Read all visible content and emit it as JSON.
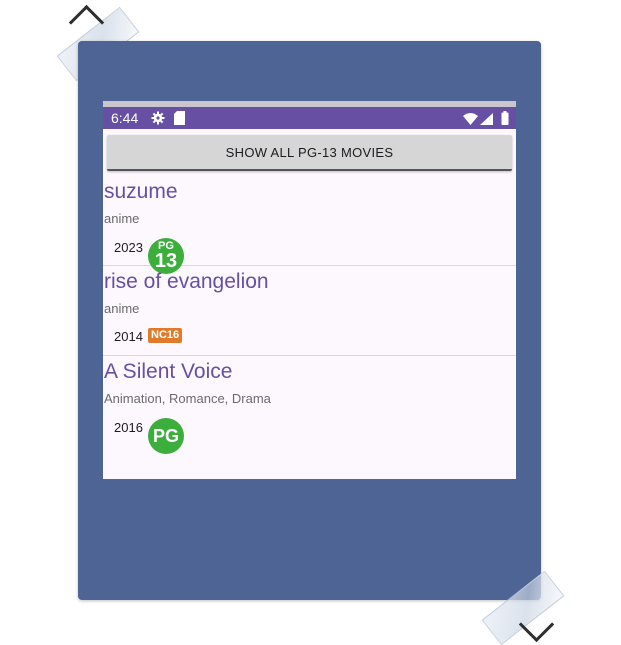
{
  "status_bar": {
    "time": "6:44",
    "icons": [
      "gear-icon",
      "sd-card-icon",
      "wifi-icon",
      "signal-icon",
      "battery-icon"
    ]
  },
  "action_button": {
    "label": "SHOW ALL PG-13 MOVIES"
  },
  "movies": [
    {
      "title": "suzume",
      "genre": "anime",
      "year": "2023",
      "rating": "PG13",
      "rating_top": "PG",
      "rating_bottom": "13"
    },
    {
      "title": "rise of evangelion",
      "genre": "anime",
      "year": "2014",
      "rating": "NC16"
    },
    {
      "title": "A Silent Voice",
      "genre": "Animation, Romance, Drama",
      "year": "2016",
      "rating": "PG"
    }
  ],
  "colors": {
    "accent": "#6750a4",
    "frame": "#4d6494",
    "rating_green": "#3cae3c",
    "rating_orange": "#e07b2a",
    "background": "#fdf8fd"
  }
}
